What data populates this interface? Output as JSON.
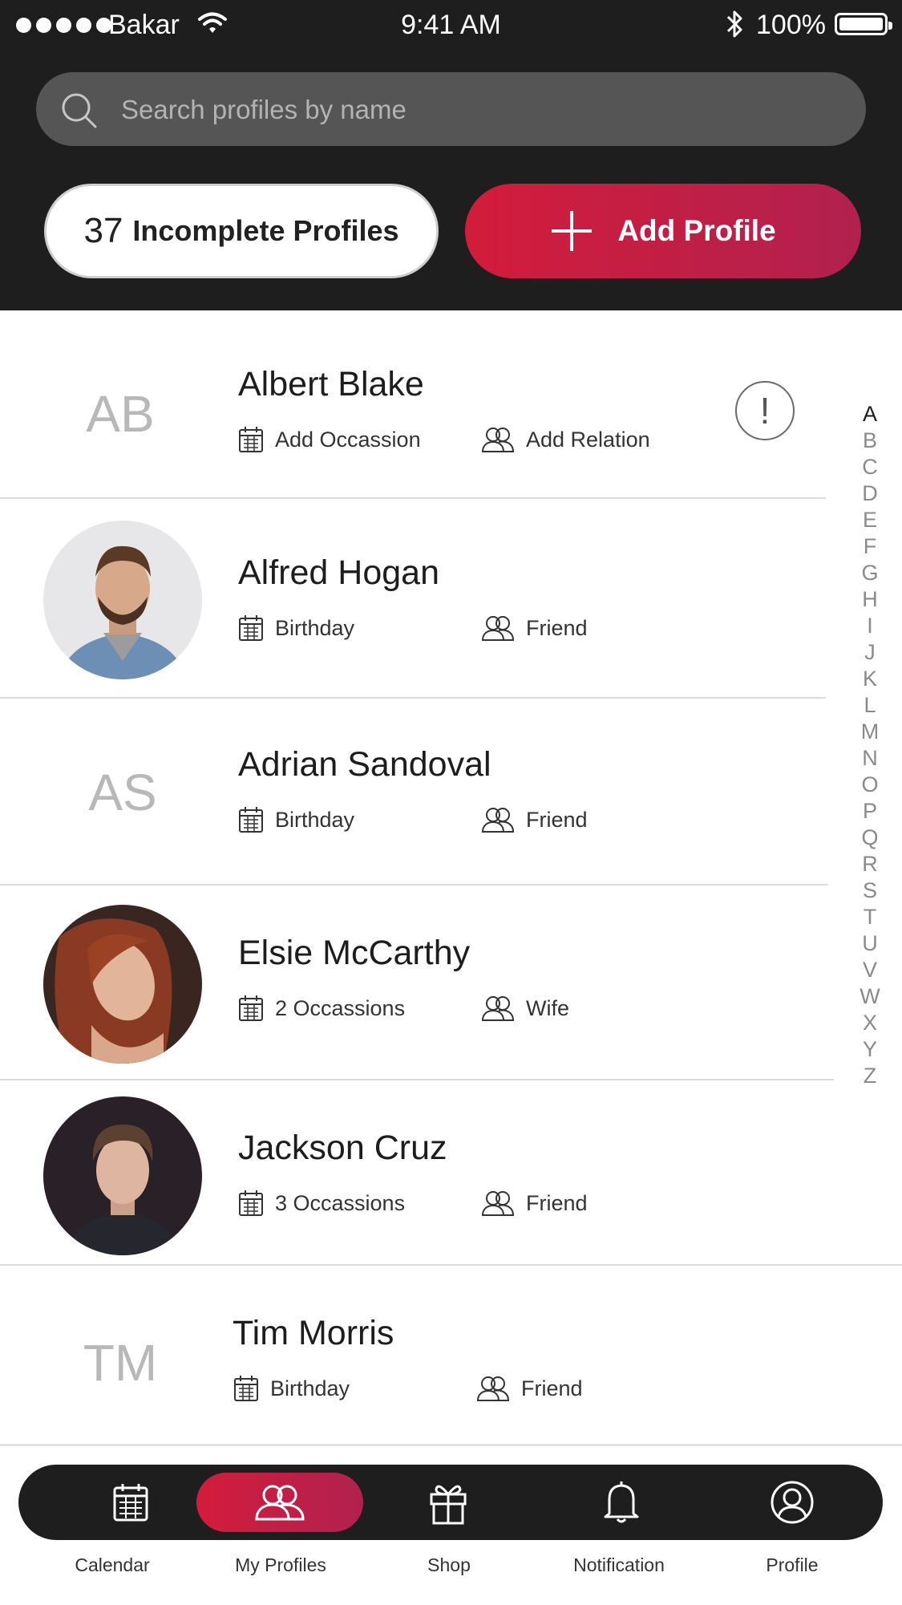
{
  "status_bar": {
    "carrier": "Bakar",
    "time": "9:41 AM",
    "battery": "100%",
    "icons": [
      "signal-dots",
      "wifi-icon",
      "bluetooth-icon",
      "battery-icon"
    ]
  },
  "search": {
    "placeholder": "Search profiles by name",
    "icon": "search-icon"
  },
  "incomplete": {
    "count": "37",
    "label": "Incomplete Profiles"
  },
  "add_profile": {
    "label": "Add Profile",
    "icon": "plus-icon"
  },
  "profiles": [
    {
      "initials": "AB",
      "name": "Albert Blake",
      "occasion": "Add Occassion",
      "relation": "Add Relation",
      "alert": "!"
    },
    {
      "name": "Alfred Hogan",
      "occasion": "Birthday",
      "relation": "Friend",
      "avatar": "photo"
    },
    {
      "initials": "AS",
      "name": "Adrian Sandoval",
      "occasion": "Birthday",
      "relation": "Friend"
    },
    {
      "name": "Elsie McCarthy",
      "occasion": "2 Occassions",
      "relation": "Wife",
      "avatar": "photo"
    },
    {
      "name": "Jackson Cruz",
      "occasion": "3 Occassions",
      "relation": "Friend",
      "avatar": "photo"
    },
    {
      "initials": "TM",
      "name": "Tim Morris",
      "occasion": "Birthday",
      "relation": "Friend"
    }
  ],
  "alphabet": [
    "A",
    "B",
    "C",
    "D",
    "E",
    "F",
    "G",
    "H",
    "I",
    "J",
    "K",
    "L",
    "M",
    "N",
    "O",
    "P",
    "Q",
    "R",
    "S",
    "T",
    "U",
    "V",
    "W",
    "X",
    "Y",
    "Z"
  ],
  "alphabet_active": "A",
  "tabs": [
    {
      "label": "Calendar",
      "icon": "calendar-icon"
    },
    {
      "label": "My Profiles",
      "icon": "profiles-icon",
      "active": true
    },
    {
      "label": "Shop",
      "icon": "gift-icon"
    },
    {
      "label": "Notification",
      "icon": "bell-icon"
    },
    {
      "label": "Profile",
      "icon": "user-icon"
    }
  ],
  "colors": {
    "header_bg": "#1e1e1e",
    "accent_start": "#d31c3b",
    "accent_end": "#b1214f",
    "search_bg": "#555555"
  }
}
